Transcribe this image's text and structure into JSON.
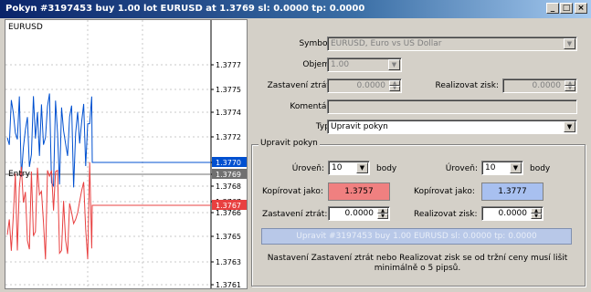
{
  "window": {
    "title": "Pokyn #3197453 buy 1.00 lot EURUSD at 1.3769 sl: 0.0000 tp: 0.0000",
    "minimize_icon": "_",
    "maximize_icon": "□",
    "close_icon": "×"
  },
  "chart": {
    "symbol": "EURUSD",
    "entry_label": "Entry",
    "price_labels": [
      "1.3777",
      "1.3775",
      "1.3774",
      "1.3772",
      "1.3770",
      "1.3769",
      "1.3768",
      "1.3767",
      "1.3766",
      "1.3765",
      "1.3763",
      "1.3761"
    ],
    "tags": {
      "ask": "1.3770",
      "entry": "1.3769",
      "bid": "1.3767"
    },
    "colors": {
      "ask": "#0050d0",
      "bid": "#e84040",
      "entry": "#707070"
    }
  },
  "form": {
    "symbol_label": "Symbol:",
    "symbol_value": "EURUSD, Euro vs US Dollar",
    "volume_label": "Objem:",
    "volume_value": "1.00",
    "sl_label": "Zastavení ztrát:",
    "sl_value": "0.0000",
    "tp_label": "Realizovat zisk:",
    "tp_value": "0.0000",
    "comment_label": "Komentář:",
    "comment_value": "",
    "type_label": "Typ:",
    "type_value": "Upravit pokyn"
  },
  "modify": {
    "group_label": "Upravit pokyn",
    "level_label_left": "Úroveň:",
    "level_value_left": "10",
    "units_left": "body",
    "level_label_right": "Úroveň:",
    "level_value_right": "10",
    "units_right": "body",
    "copy_label_left": "Kopírovat jako:",
    "copy_value_left": "1.3757",
    "copy_label_right": "Kopírovat jako:",
    "copy_value_right": "1.3777",
    "sl_label": "Zastavení ztrát:",
    "sl_value": "0.0000",
    "tp_label": "Realizovat zisk:",
    "tp_value": "0.0000",
    "modify_button": "Upravit #3197453 buy 1.00 EURUSD sl: 0.0000 tp: 0.0000",
    "note": "Nastavení Zastavení ztrát nebo Realizovat zisk se od tržní ceny musí lišit minimálně o 5 pipsů.",
    "colors": {
      "copy_left": "#f08080",
      "copy_right": "#a8c0f0"
    }
  }
}
